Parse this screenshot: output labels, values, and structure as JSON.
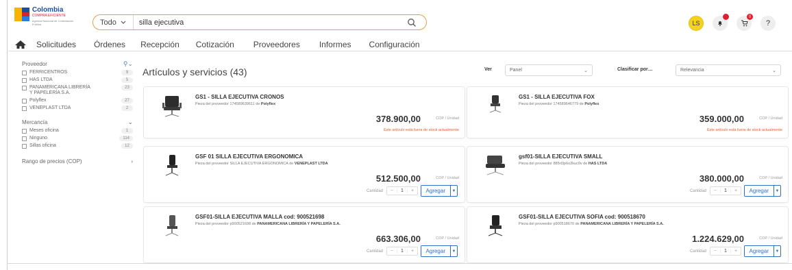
{
  "brand": {
    "title": "Colombia",
    "sub": "COMPRA EFICIENTE",
    "sub2": "Agencia Nacional de Contratación Pública"
  },
  "search": {
    "scope": "Todo",
    "query": "silla ejecutiva"
  },
  "header": {
    "avatar": "LS",
    "cart_badge": "0",
    "help": "?"
  },
  "nav": [
    "Solicitudes",
    "Órdenes",
    "Recepción",
    "Cotización",
    "Proveedores",
    "Informes",
    "Configuración"
  ],
  "sidebar": {
    "proveedor_title": "Proveedor",
    "proveedores": [
      {
        "label": "FERRICENTROS",
        "count": "9"
      },
      {
        "label": "HAS LTDA",
        "count": "5"
      },
      {
        "label": "PANAMERICANA LIBRERÍA Y PAPELERÍA S.A.",
        "count": "23"
      },
      {
        "label": "Polyflex",
        "count": "27"
      },
      {
        "label": "VENEPLAST LTDA",
        "count": "2"
      }
    ],
    "mercancia_title": "Mercancía",
    "mercancias": [
      {
        "label": "Meses oficina",
        "count": "1"
      },
      {
        "label": "Ninguno",
        "count": "114"
      },
      {
        "label": "Sillas oficina",
        "count": "12"
      }
    ],
    "precio_title": "Rango de precios (COP)"
  },
  "main": {
    "title": "Artículos y servicios (43)",
    "ver_label": "Ver",
    "ver_value": "Panel",
    "sort_label": "Clasificar por…",
    "sort_value": "Relevancia"
  },
  "labels": {
    "unit": "COP / Unidad",
    "qty": "Cantidad",
    "add": "Agregar",
    "oos": "Este artículo está fuera de stock actualmente"
  },
  "products": [
    {
      "title": "GS1 - SILLA EJECUTIVA CRONOS",
      "sub_pre": "Pieza del proveedor 174589639611 de ",
      "vendor": "Polyflex",
      "price": "378.900,00",
      "qty": "1",
      "out_of_stock": true
    },
    {
      "title": "GS1 - SILLA EJECUTIVA FOX",
      "sub_pre": "Pieza del proveedor 174589646779 de ",
      "vendor": "Polyflex",
      "price": "359.000,00",
      "qty": "1",
      "out_of_stock": true
    },
    {
      "title": "GSF 01 SILLA EJECUTIVA ERGONOMICA",
      "sub_pre": "Pieza del proveedor SILLA EJECUTIVA ERGONOMICA de ",
      "vendor": "VENEPLAST LTDA",
      "price": "512.500,00",
      "qty": "1",
      "out_of_stock": false
    },
    {
      "title": "gsf01-SILLA EJECUTIVA SMALL",
      "sub_pre": "Pieza del proveedor 885rt3p6o2kuc0v de ",
      "vendor": "HAS LTDA",
      "price": "380.000,00",
      "qty": "1",
      "out_of_stock": false
    },
    {
      "title": "GSF01-SILLA EJECUTIVA MALLA cod: 900521698",
      "sub_pre": "Pieza del proveedor p900521698 de ",
      "vendor": "PANAMERICANA LIBRERÍA Y PAPELERÍA S.A.",
      "price": "663.306,00",
      "qty": "1",
      "out_of_stock": false
    },
    {
      "title": "GSF01-SILLA EJECUTIVA SOFIA cod: 900518670",
      "sub_pre": "Pieza del proveedor p900518670 de ",
      "vendor": "PANAMERICANA LIBRERÍA Y PAPELERÍA S.A.",
      "price": "1.224.629,00",
      "qty": "1",
      "out_of_stock": false
    }
  ]
}
